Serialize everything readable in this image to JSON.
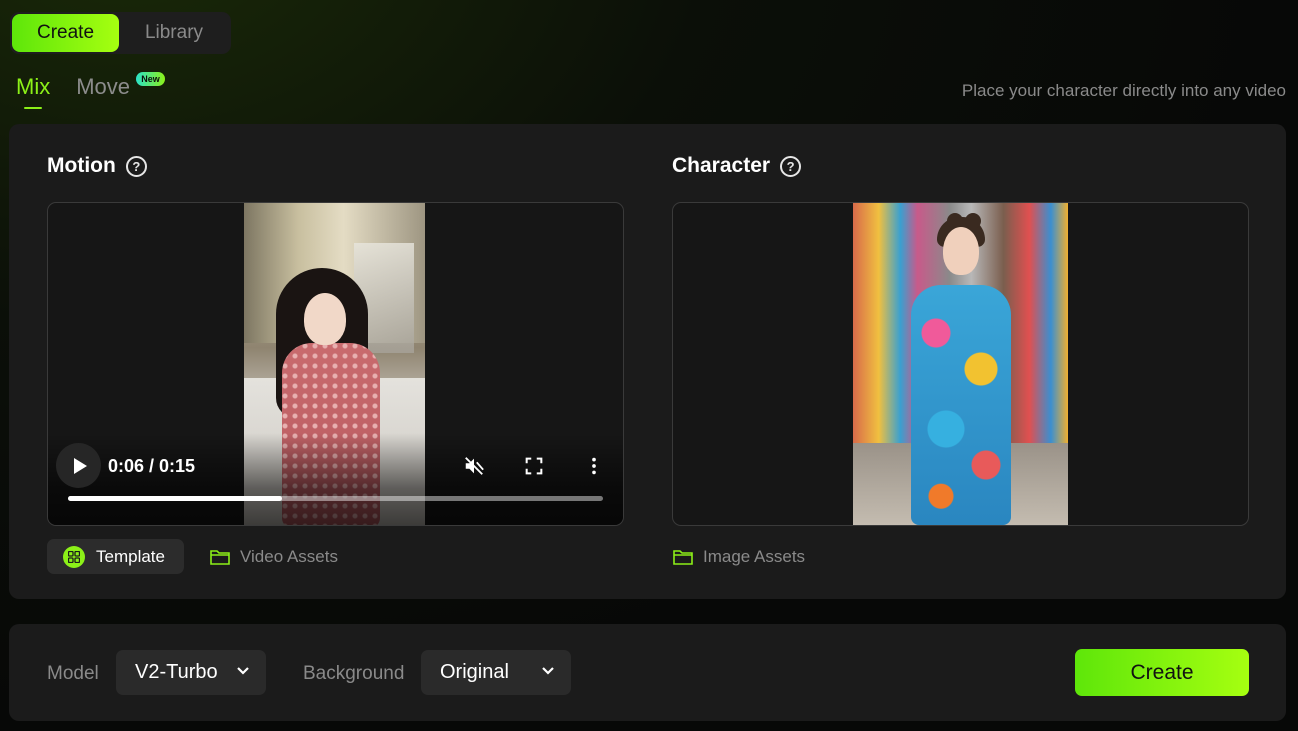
{
  "top_tabs": [
    {
      "label": "Create",
      "active": true
    },
    {
      "label": "Library",
      "active": false
    }
  ],
  "mode_tabs": {
    "mix": "Mix",
    "move": "Move",
    "move_badge": "New"
  },
  "tagline": "Place your character directly into any video",
  "motion": {
    "title": "Motion",
    "help_icon": "question-circle-icon",
    "player": {
      "time": "0:06 / 0:15",
      "progress": 0.4,
      "muted": true
    },
    "template_label": "Template",
    "video_assets_label": "Video Assets"
  },
  "character": {
    "title": "Character",
    "help_icon": "question-circle-icon",
    "image_assets_label": "Image Assets"
  },
  "settings": {
    "model_label": "Model",
    "model_value": "V2-Turbo",
    "background_label": "Background",
    "background_value": "Original"
  },
  "create_button": "Create",
  "colors": {
    "accent": "#8cf018",
    "accent_gradient_start": "#5ee60a",
    "accent_gradient_end": "#a6ff10",
    "card": "#1b1b1b",
    "muted_text": "#8a8a8a"
  }
}
